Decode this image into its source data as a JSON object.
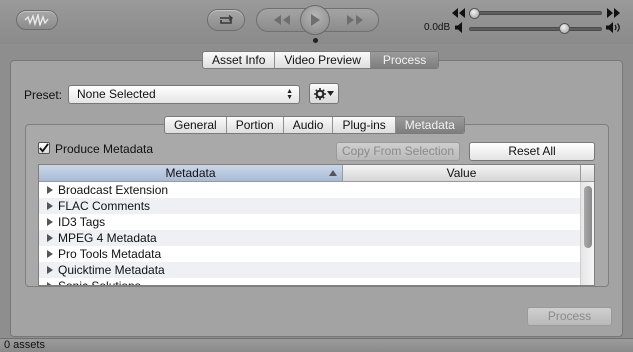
{
  "toolbar": {
    "logo_icon": "waveform-icon",
    "loop_icon": "loop-icon",
    "rewind_icon": "rewind-icon",
    "play_icon": "play-icon",
    "forward_icon": "fast-forward-icon",
    "volume_db": "0.0dB",
    "position_fraction": 0.0,
    "volume_fraction": 0.74
  },
  "view_tabs": {
    "items": [
      "Asset Info",
      "Video Preview",
      "Process"
    ],
    "active": "Process"
  },
  "preset": {
    "label": "Preset:",
    "value": "None Selected",
    "gear_icon": "gear-icon"
  },
  "process_tabs": {
    "items": [
      "General",
      "Portion",
      "Audio",
      "Plug-ins",
      "Metadata"
    ],
    "active": "Metadata"
  },
  "metadata": {
    "produce_checkbox_label": "Produce Metadata",
    "produce_checked": true,
    "copy_button": "Copy From Selection",
    "copy_enabled": false,
    "reset_button": "Reset All",
    "columns": [
      "Metadata",
      "Value"
    ],
    "rows": [
      "Broadcast Extension",
      "FLAC Comments",
      "ID3 Tags",
      "MPEG 4 Metadata",
      "Pro Tools Metadata",
      "Quicktime Metadata",
      "Sonic Solutions"
    ]
  },
  "process_button": "Process",
  "process_enabled": false,
  "status": {
    "text": "0 assets"
  },
  "colors": {
    "window_bg": "#8e8e8e",
    "active_tab": "#8a8a8a",
    "sort_header": "#b7c6dc"
  }
}
